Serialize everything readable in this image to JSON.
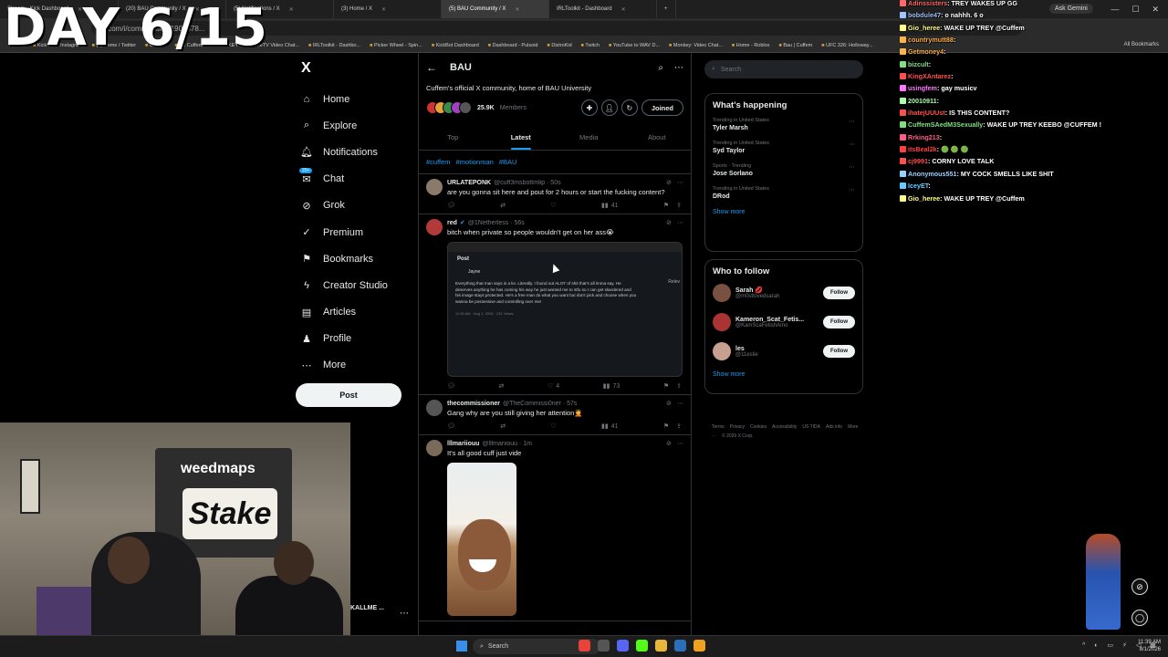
{
  "overlay": {
    "day_title": "DAY 6/15"
  },
  "browser": {
    "tabs": [
      {
        "label": "Stream - Kick Dashboard",
        "active": false
      },
      {
        "label": "(20) BAU Community / X",
        "active": false
      },
      {
        "label": "(5) Notifications / X",
        "active": false
      },
      {
        "label": "(3) Home / X",
        "active": false
      },
      {
        "label": "(5) BAU Community / X",
        "active": true
      },
      {
        "label": "IRLToolkit - Dashboard",
        "active": false
      }
    ],
    "url": "x.com/i/communities/1908678...",
    "ask_gemini": "Ask Gemini",
    "bookmarks": [
      "Kick",
      "Instagram",
      "(7) Home / Twitter",
      "Cuffem",
      "(7) Cuffem",
      "MONKEY",
      "OmeTV Video Chat...",
      "IRLToolkit - Dashbo...",
      "Picker Wheel - Spin...",
      "KickBot Dashboard",
      "Dashboard - Pulsoid",
      "DistroKid",
      "Twitch",
      "YouTube to WAV D...",
      "Monkey: Video Chat...",
      "Home - Roblox",
      "Bau | Cuffem",
      "UFC 326: Holloway..."
    ],
    "all_bookmarks": "All Bookmarks"
  },
  "nav": {
    "logo": "X",
    "items": [
      {
        "label": "Home",
        "icon": "home-icon",
        "glyph": "⌂"
      },
      {
        "label": "Explore",
        "icon": "search-icon",
        "glyph": "⌕"
      },
      {
        "label": "Notifications",
        "icon": "bell-icon",
        "glyph": "🔔︎"
      },
      {
        "label": "Chat",
        "icon": "chat-icon",
        "glyph": "✉",
        "badge": "20+"
      },
      {
        "label": "Grok",
        "icon": "grok-icon",
        "glyph": "⊘"
      },
      {
        "label": "Premium",
        "icon": "premium-icon",
        "glyph": "✓"
      },
      {
        "label": "Bookmarks",
        "icon": "bookmark-icon",
        "glyph": "⚑"
      },
      {
        "label": "Creator Studio",
        "icon": "lightning-icon",
        "glyph": "ϟ"
      },
      {
        "label": "Articles",
        "icon": "articles-icon",
        "glyph": "▤"
      },
      {
        "label": "Profile",
        "icon": "person-icon",
        "glyph": "♟"
      },
      {
        "label": "More",
        "icon": "more-icon",
        "glyph": "⋯"
      }
    ],
    "post_label": "Post",
    "account_name": "KALLME ..."
  },
  "community": {
    "name": "BAU",
    "description": "Cuffem's official X community, home of BAU University",
    "members_count": "25.9K",
    "members_label": "Members",
    "joined_label": "Joined",
    "tabs": [
      {
        "label": "Top",
        "active": false
      },
      {
        "label": "Latest",
        "active": true
      },
      {
        "label": "Media",
        "active": false
      },
      {
        "label": "About",
        "active": false
      }
    ],
    "hashtags": [
      "#cuffem",
      "#motionman",
      "#BAU"
    ]
  },
  "tweets": [
    {
      "name": "URLATEPONK",
      "handle": "@cuff3msbottmlip · 50s",
      "verified": false,
      "text": "are you gonna sit here and pout for 2 hours or start the fucking content?",
      "likes": "",
      "views": "41",
      "avatar": "#8a7a6a"
    },
    {
      "name": "red",
      "handle": "@1Netherless · 56s",
      "verified": true,
      "text": "bitch when private so people wouldn't get on her ass😭",
      "likes": "4",
      "views": "73",
      "avatar": "#b23a3a",
      "embed": {
        "header": "Post",
        "author": "Jayne",
        "text": "Everything that man says is a lie. Literally. I found out ALOT of shit that's all imma say. He deserves anything he has coming his way he just wanted me to stfu so I can get slandered and his image stays protected. He's a free man do what you want but don't pick and choose when you wanna be possessive and controlling over me!",
        "time": "11:30 AM · Aug 1, 2026 · 231 Views",
        "side": "Relev"
      }
    },
    {
      "name": "thecommissioner",
      "handle": "@TheCommissi0ner · 57s",
      "verified": false,
      "text": "Gang why are you still giving her attention🤦",
      "likes": "",
      "views": "41",
      "avatar": "#555"
    },
    {
      "name": "lllmariiouu",
      "handle": "@lllmariiouu · 1m",
      "verified": false,
      "text": "It's all good cuff just vide",
      "likes": "",
      "views": "",
      "avatar": "#7a6a5a"
    }
  ],
  "right": {
    "search_placeholder": "Search",
    "happening_title": "What's happening",
    "trends": [
      {
        "context": "Trending in United States",
        "name": "Tyler Marsh"
      },
      {
        "context": "Trending in United States",
        "name": "Syd Taylor"
      },
      {
        "context": "Sports · Trending",
        "name": "Jose Sorlano"
      },
      {
        "context": "Trending in United States",
        "name": "DRod"
      }
    ],
    "show_more": "Show more",
    "wtf_title": "Who to follow",
    "follow_label": "Follow",
    "wtf": [
      {
        "name": "Sarah 💋",
        "handle": "@m0stlovedsarah",
        "avatar": "#7a5040"
      },
      {
        "name": "Kameron_Scat_Fetis...",
        "handle": "@KamScaFetishAmo",
        "avatar": "#a33"
      },
      {
        "name": "les",
        "handle": "@11eslie",
        "avatar": "#c8a090"
      }
    ],
    "footer": [
      "Terms",
      "Privacy",
      "Cookies",
      "Accessibility",
      "US TIDA",
      "Ads info",
      "More ···",
      "© 2026 X Corp."
    ]
  },
  "chat": [
    {
      "user": "Adinssisters",
      "msg": "TREY WAKES UP GG",
      "color": "#ff6b6b"
    },
    {
      "user": "bobdule47",
      "msg": "o nahhh. 6 o",
      "color": "#a0c4ff"
    },
    {
      "user": "Gio_heree",
      "msg": "WAKE UP TREY @Cuffem",
      "color": "#fffd8a"
    },
    {
      "user": "countrymutt88",
      "msg": "",
      "color": "#ffb347"
    },
    {
      "user": "Getmoney4",
      "msg": "",
      "color": "#ffb347"
    },
    {
      "user": "bizcult",
      "msg": "",
      "color": "#7ee07e"
    },
    {
      "user": "KingXAntarez",
      "msg": "",
      "color": "#ff5050"
    },
    {
      "user": "usingfem",
      "msg": "gay musicv",
      "color": "#ff77ff"
    },
    {
      "user": "20010911",
      "msg": "",
      "color": "#aaffaa"
    },
    {
      "user": "ihatejUUUst",
      "msg": "IS THIS CONTENT?",
      "color": "#ff5050"
    },
    {
      "user": "CuffemSAedM3Sexually",
      "msg": "WAKE UP TREY KEEBO @CUFFEM !",
      "color": "#7ee07e"
    },
    {
      "user": "Rrking213",
      "msg": "",
      "color": "#ff5c8a"
    },
    {
      "user": "itsBeal2k",
      "msg": "🟢 🟢 🟢",
      "color": "#ff4040"
    },
    {
      "user": "cj9991",
      "msg": "CORNY LOVE TALK",
      "color": "#ff5050"
    },
    {
      "user": "Anonymous551",
      "msg": "MY COCK SMELLS LIKE SHIT",
      "color": "#9ad0ff"
    },
    {
      "user": "IceyET",
      "msg": "",
      "color": "#66ccff"
    },
    {
      "user": "Gio_heree",
      "msg": "WAKE UP TREY @Cuffem",
      "color": "#fffd8a"
    }
  ],
  "taskbar": {
    "search_label": "Search",
    "time": "11:39 AM",
    "date": "8/1/2026"
  },
  "webcam": {
    "banner_top": "weedmaps",
    "banner_main": "Stake"
  }
}
